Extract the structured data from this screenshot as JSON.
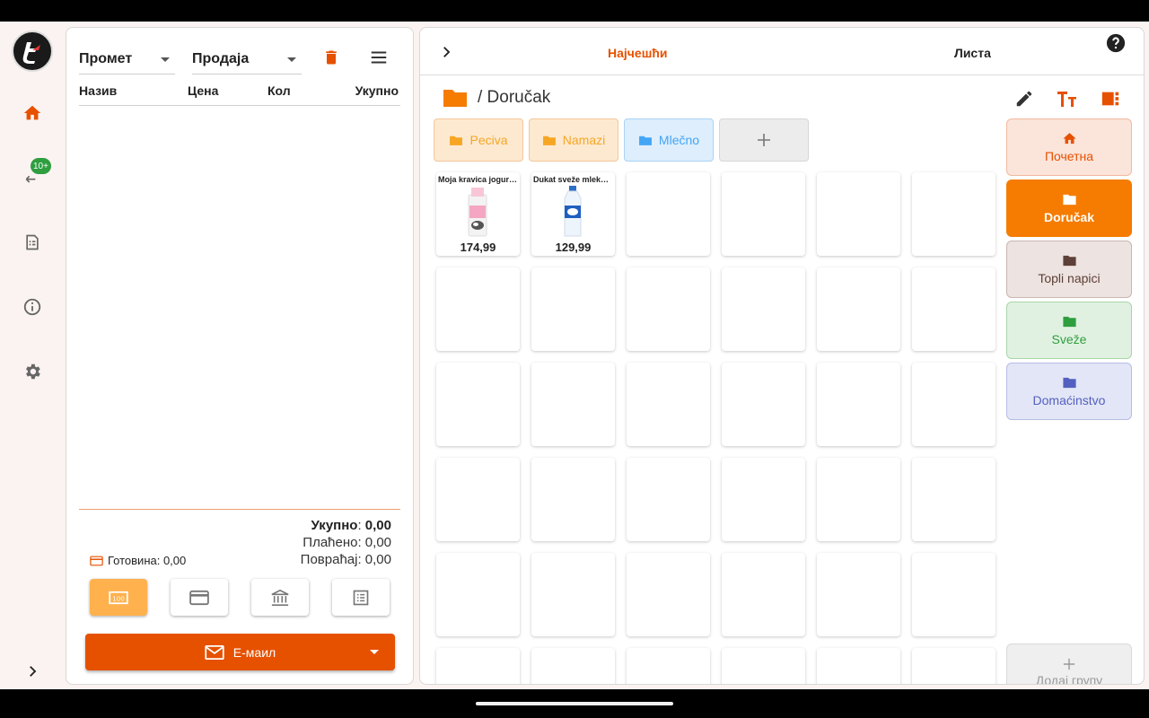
{
  "sidebar": {
    "badge": "10+",
    "items": [
      {
        "icon": "home-icon",
        "active": true
      },
      {
        "icon": "sync-icon"
      },
      {
        "icon": "receipt-icon"
      },
      {
        "icon": "info-icon"
      },
      {
        "icon": "gear-icon"
      },
      {
        "icon": "chevron-right-icon"
      }
    ]
  },
  "cart": {
    "select_mode": "Промет",
    "select_type": "Продаја",
    "columns": {
      "name": "Назив",
      "price": "Цена",
      "qty": "Кол",
      "total": "Укупно"
    },
    "totals": {
      "total_label": "Укупно",
      "total_value": "0,00",
      "paid": "Плаћено: 0,00",
      "change": "Повраћај: 0,00"
    },
    "cash": "Готовина: 0,00",
    "email_button": "Е-маил"
  },
  "products": {
    "tabs": {
      "frequent": "Најчешћи",
      "list": "Листа"
    },
    "breadcrumb": "/ Doručak",
    "subgroups": [
      {
        "label": "Peciva",
        "color": "#f6a623"
      },
      {
        "label": "Namazi",
        "color": "#f6a623"
      },
      {
        "label": "Mlečno",
        "color": "#42a5f5"
      }
    ],
    "items": [
      {
        "name": "Moja kravica jogurt ...",
        "price": "174,99"
      },
      {
        "name": "Dukat sveže mleko 2....",
        "price": "129,99"
      }
    ],
    "groups": [
      {
        "label": "Почетна",
        "icon": "home-icon",
        "bg": "#fbe4da",
        "border": "#f2b9a0",
        "color": "#e65100"
      },
      {
        "label": "Doručak",
        "icon": "folder-icon",
        "bg": "#f57c00",
        "border": "#f57c00",
        "color": "#ffffff",
        "active": true
      },
      {
        "label": "Topli napici",
        "icon": "folder-icon",
        "bg": "#ede3e0",
        "border": "#c9b6b0",
        "color": "#5d4037"
      },
      {
        "label": "Sveže",
        "icon": "folder-icon",
        "bg": "#e1f1e1",
        "border": "#a8d5a8",
        "color": "#2e9e3f"
      },
      {
        "label": "Domaćinstvo",
        "icon": "folder-icon",
        "bg": "#e3e6f6",
        "border": "#b6bde6",
        "color": "#5360c0"
      }
    ],
    "add_group": "Додај групу"
  },
  "colors": {
    "accent": "#e65100",
    "orange": "#f57c00"
  }
}
